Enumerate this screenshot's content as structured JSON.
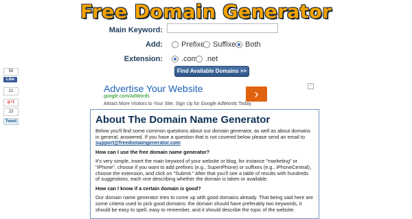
{
  "logo": {
    "text": "Free Domain Generator"
  },
  "form": {
    "keyword_label": "Main Keyword:",
    "keyword_value": "",
    "add_label": "Add:",
    "add_options": [
      "Prefixes",
      "Suffixes",
      "Both"
    ],
    "add_selected": "Both",
    "extension_label": "Extension:",
    "extension_options": [
      ".com",
      ".net"
    ],
    "extension_selected": ".com",
    "submit_label": "Find Available Domains >>"
  },
  "social": {
    "fb_count": "58",
    "fb_like": "Like",
    "count_22": "22",
    "gplus": "g+1",
    "count_23": "23",
    "tweet": "Tweet"
  },
  "ad": {
    "title": "Advertise Your Website",
    "url": "google.com/AdWords",
    "description": "Attract More Visitors to Your Site. Sign Up for Google AdWords Today.",
    "arrow": "›"
  },
  "content": {
    "heading": "About The Domain Name Generator",
    "intro": "Below you'll find some common questions about our domain generator, as well as about domains in general, answered. If you have a question that is not covered below please send an email to",
    "email": "support@freedomaingenerator.com",
    "q1": "How can I use the free domain name generator?",
    "a1": "It's very simple, insert the main keyword of your website or blog, for instance \"marketing\" or \"iPhone\", choose if you want to add prefixes (e.g., SuperiPhone) or suffixes (e.g., iPhoneCentral), choose the extension, and click on \"Submit.\" After that you'll see a table of results with hundreds of suggestions, each one describing whether the domain is taken or available.",
    "q2": "How can I know if a certain domain is good?",
    "a2": "Our domain name generator tries to come up with good domains already. That being said here are some criteria used to pick good domains: the domain should have preferably two keywords, it should be easy to spell, easy to remember, and it should describe the topic of the website."
  }
}
